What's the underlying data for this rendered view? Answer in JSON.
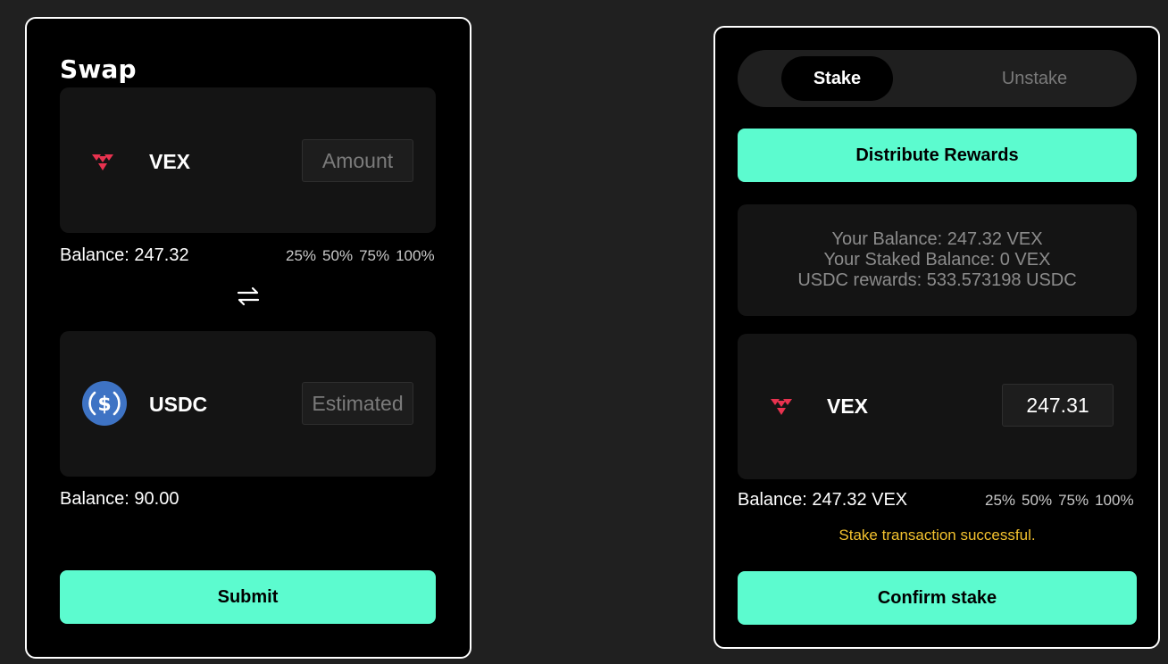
{
  "swap": {
    "title": "Swap",
    "from": {
      "token": "VEX",
      "icon": "vex-logo-icon",
      "amount_placeholder": "Amount",
      "balance": "Balance: 247.32"
    },
    "percentages": [
      "25%",
      "50%",
      "75%",
      "100%"
    ],
    "swap_icon": "swap-arrows-icon",
    "to": {
      "token": "USDC",
      "icon": "usdc-logo-icon",
      "amount_placeholder": "Estimated",
      "balance": "Balance: 90.00"
    },
    "submit_label": "Submit"
  },
  "stake": {
    "tabs": [
      {
        "label": "Stake",
        "active": true
      },
      {
        "label": "Unstake",
        "active": false
      }
    ],
    "distribute_label": "Distribute Rewards",
    "info": {
      "your_balance": "Your Balance: 247.32 VEX",
      "staked_balance": "Your Staked Balance: 0 VEX",
      "rewards": "USDC rewards: 533.573198 USDC"
    },
    "token": "VEX",
    "icon": "vex-logo-icon",
    "amount_value": "247.31",
    "balance": "Balance: 247.32 VEX",
    "percentages": [
      "25%",
      "50%",
      "75%",
      "100%"
    ],
    "status": "Stake transaction successful.",
    "confirm_label": "Confirm stake"
  },
  "colors": {
    "background": "#202020",
    "panel": "#000000",
    "accent": "#5cfbcf",
    "vex_red": "#e8324f",
    "usdc_blue": "#3e73c4",
    "success": "#f2c12e"
  }
}
